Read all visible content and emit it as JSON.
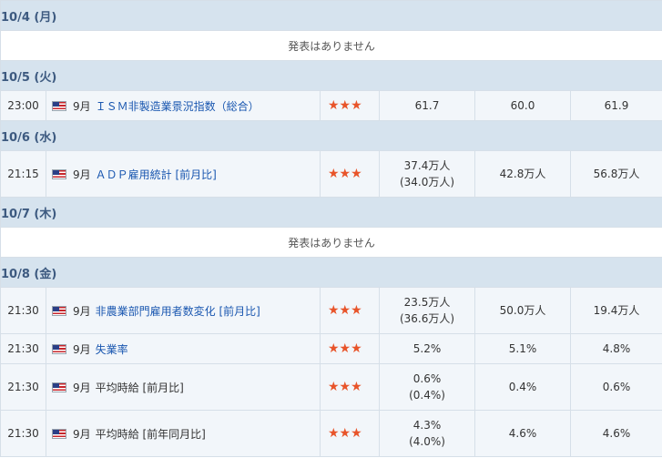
{
  "colors": {
    "date_header_bg": "#d6e3ee",
    "date_header_text": "#3d5a80",
    "event_row_bg": "#f2f6fa",
    "link_text": "#1a57b0",
    "star": "#e8542a",
    "border": "#d6dfe8"
  },
  "icons": {
    "flag": "us-flag-icon",
    "star": "star-icon"
  },
  "days": [
    {
      "date": "10/4 (月)",
      "no_events_text": "発表はありません",
      "events": []
    },
    {
      "date": "10/5 (火)",
      "events": [
        {
          "time": "23:00",
          "month": "9月",
          "name": "ＩＳＭ非製造業景況指数（総合）",
          "link": true,
          "stars": "★★★",
          "actual": "61.7",
          "actual_revised": "",
          "forecast": "60.0",
          "previous": "61.9"
        }
      ]
    },
    {
      "date": "10/6 (水)",
      "events": [
        {
          "time": "21:15",
          "month": "9月",
          "name": "ＡＤＰ雇用統計 [前月比]",
          "link": true,
          "stars": "★★★",
          "actual": "37.4万人",
          "actual_revised": "(34.0万人)",
          "forecast": "42.8万人",
          "previous": "56.8万人"
        }
      ]
    },
    {
      "date": "10/7 (木)",
      "no_events_text": "発表はありません",
      "events": []
    },
    {
      "date": "10/8 (金)",
      "events": [
        {
          "time": "21:30",
          "month": "9月",
          "name": "非農業部門雇用者数変化 [前月比]",
          "link": true,
          "stars": "★★★",
          "actual": "23.5万人",
          "actual_revised": "(36.6万人)",
          "forecast": "50.0万人",
          "previous": "19.4万人"
        },
        {
          "time": "21:30",
          "month": "9月",
          "name": "失業率",
          "link": true,
          "stars": "★★★",
          "actual": "5.2%",
          "actual_revised": "",
          "forecast": "5.1%",
          "previous": "4.8%"
        },
        {
          "time": "21:30",
          "month": "9月",
          "name": "平均時給 [前月比]",
          "link": false,
          "stars": "★★★",
          "actual": "0.6%",
          "actual_revised": "(0.4%)",
          "forecast": "0.4%",
          "previous": "0.6%"
        },
        {
          "time": "21:30",
          "month": "9月",
          "name": "平均時給 [前年同月比]",
          "link": false,
          "stars": "★★★",
          "actual": "4.3%",
          "actual_revised": "(4.0%)",
          "forecast": "4.6%",
          "previous": "4.6%"
        }
      ]
    }
  ]
}
